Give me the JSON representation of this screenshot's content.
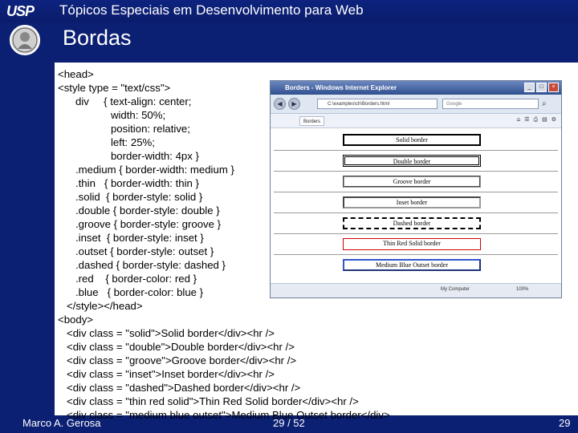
{
  "header": {
    "logo_text": "USP",
    "course_title": "Tópicos Especiais em Desenvolvimento para Web",
    "slide_title": "Bordas"
  },
  "code_lines": [
    "<head>",
    "<style type = \"text/css\">",
    "      div     { text-align: center;",
    "                  width: 50%;",
    "                  position: relative;",
    "                  left: 25%;",
    "                  border-width: 4px }",
    "      .medium { border-width: medium }",
    "      .thin   { border-width: thin }",
    "      .solid  { border-style: solid }",
    "      .double { border-style: double }",
    "      .groove { border-style: groove }",
    "      .inset  { border-style: inset }",
    "      .outset { border-style: outset }",
    "      .dashed { border-style: dashed }",
    "      .red    { border-color: red }",
    "      .blue   { border-color: blue }",
    "   </style></head>",
    "<body>",
    "   <div class = \"solid\">Solid border</div><hr />",
    "   <div class = \"double\">Double border</div><hr />",
    "   <div class = \"groove\">Groove border</div><hr />",
    "   <div class = \"inset\">Inset border</div><hr />",
    "   <div class = \"dashed\">Dashed border</div><hr />",
    "   <div class = \"thin red solid\">Thin Red Solid border</div><hr />",
    "   <div class = \"medium blue outset\">Medium Blue Outset border</div>"
  ],
  "browser": {
    "window_title": "Borders - Windows Internet Explorer",
    "url": "C:\\examples\\ch\\Borders.html",
    "search_placeholder": "Google",
    "favorite_tab": "Borders",
    "status_zone": "My Computer",
    "zoom": "100%",
    "demo_borders": [
      {
        "label": "Solid border",
        "style": "solid",
        "color": "#000000"
      },
      {
        "label": "Double border",
        "style": "double",
        "color": "#000000"
      },
      {
        "label": "Groove border",
        "style": "groove",
        "color": "#999999"
      },
      {
        "label": "Inset border",
        "style": "inset",
        "color": "#999999"
      },
      {
        "label": "Dashed border",
        "style": "dashed",
        "color": "#000000"
      },
      {
        "label": "Thin Red Solid border",
        "style": "solid",
        "color": "#cc0000"
      },
      {
        "label": "Medium Blue Outset border",
        "style": "outset",
        "color": "#3355cc"
      }
    ]
  },
  "footer": {
    "author": "Marco A. Gerosa",
    "page_indicator": "29 / 52",
    "slide_number": "29"
  },
  "colors": {
    "background": "#0b1f73",
    "content_background": "#ffffff"
  }
}
